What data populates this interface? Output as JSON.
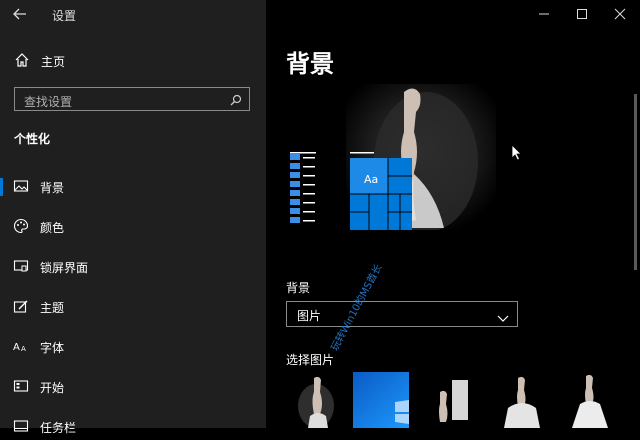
{
  "titlebar": {
    "app_title": "设置",
    "back_icon": "back-arrow-icon"
  },
  "sidebar": {
    "home_label": "主页",
    "search_placeholder": "查找设置",
    "section_title": "个性化",
    "items": [
      {
        "label": "背景",
        "icon": "background-picture-icon",
        "selected": true
      },
      {
        "label": "颜色",
        "icon": "palette-icon",
        "selected": false
      },
      {
        "label": "锁屏界面",
        "icon": "lock-screen-icon",
        "selected": false
      },
      {
        "label": "主题",
        "icon": "theme-icon",
        "selected": false
      },
      {
        "label": "字体",
        "icon": "font-icon",
        "selected": false
      },
      {
        "label": "开始",
        "icon": "start-icon",
        "selected": false
      },
      {
        "label": "任务栏",
        "icon": "taskbar-icon",
        "selected": false
      }
    ]
  },
  "main": {
    "page_title": "背景",
    "preview_tile_label": "Aa",
    "background_label": "背景",
    "background_value": "图片",
    "choose_picture_label": "选择图片",
    "watermark": "玩转Win10的MS酋长"
  },
  "colors": {
    "accent": "#0078d7",
    "sidebar_bg": "#1f1f1f",
    "main_bg": "#000000"
  }
}
